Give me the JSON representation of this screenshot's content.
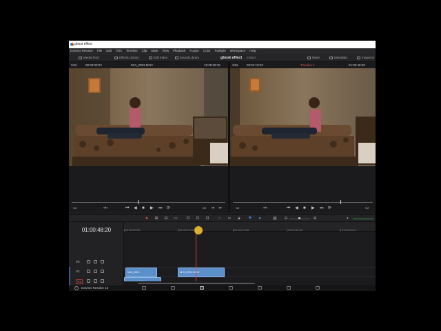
{
  "window": {
    "title": "ghost effect"
  },
  "menu": [
    "DaVinci Resolve",
    "File",
    "Edit",
    "Trim",
    "Timeline",
    "Clip",
    "Mark",
    "View",
    "Playback",
    "Fusion",
    "Color",
    "Fairlight",
    "Workspace",
    "Help"
  ],
  "toolbar": {
    "media_pool": "Media Pool",
    "effects_library": "Effects Library",
    "edit_index": "Edit Index",
    "sound_library": "Sound Library",
    "project_name": "ghost effect",
    "edited": "Edited",
    "mixer": "Mixer",
    "metadata": "Metadata",
    "inspector": "Inspector"
  },
  "source_viewer": {
    "zoom": "34%",
    "timecode": "00:00:03:03",
    "clip_name": "MVI_2091.MOV",
    "clip_timecode": "12:29:28:15"
  },
  "timeline_viewer": {
    "zoom": "34%",
    "timecode": "00:01:10:03",
    "timeline_name": "Timeline 1",
    "timeline_timecode": "01:00:48:20"
  },
  "timeline": {
    "current_timecode": "01:00:48:20",
    "ruler_ticks": [
      "01:00:00:00",
      "01:00:37:09",
      "01:01:14:18",
      "01:01:52:03",
      "01:02:29:12"
    ],
    "tracks": [
      {
        "name": "V3"
      },
      {
        "name": "V2"
      },
      {
        "name": "V1"
      },
      {
        "name": "A1",
        "level": "2.0"
      }
    ],
    "clips": {
      "v2_a": "MVI_209...",
      "v2_b": "MVI_2091.MOV",
      "v1": "MVI_2091.MOV"
    }
  },
  "footer": {
    "app_name": "DaVinci Resolve 16"
  },
  "colors": {
    "clip_blue": "#5b8fc9",
    "playhead_red": "#d9443a",
    "cursor_highlight": "#f0c030"
  }
}
